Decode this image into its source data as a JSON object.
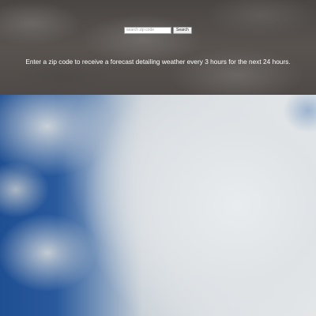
{
  "search": {
    "placeholder": "search zip code",
    "value": "",
    "button_label": "Search"
  },
  "instructions": "Enter a zip code to receive a forecast detailing weather every 3 hours for the next 24 hours."
}
